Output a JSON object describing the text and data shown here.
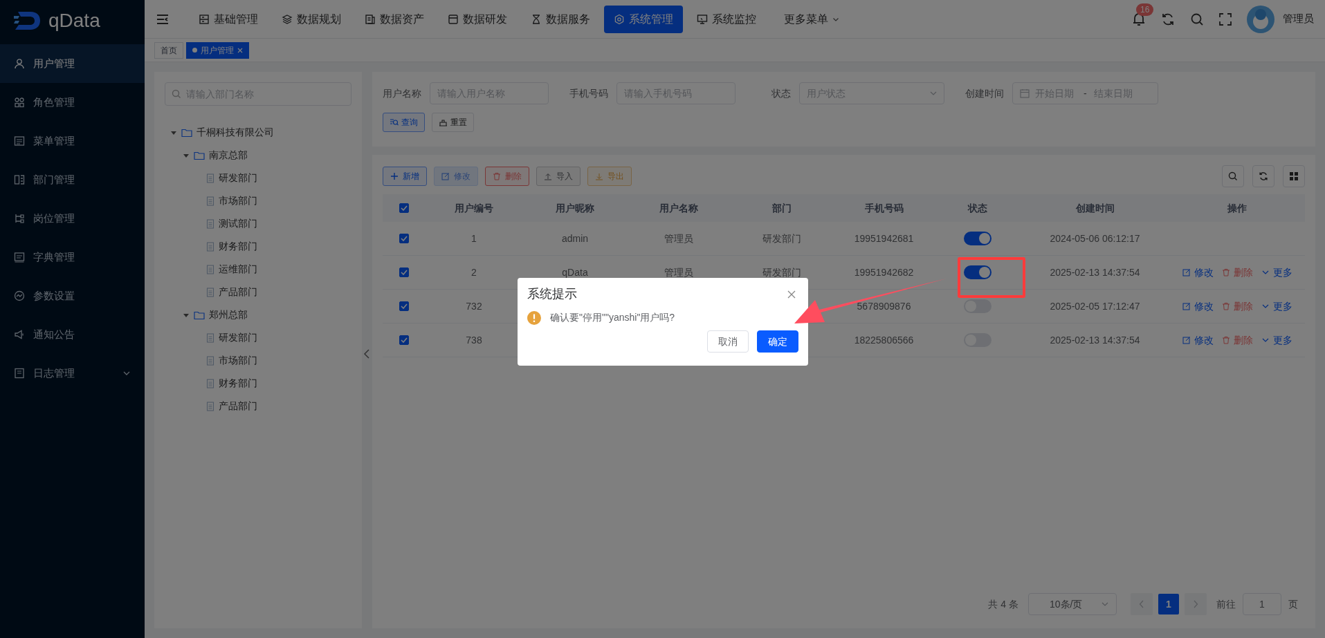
{
  "sidebar": {
    "logo": "qData",
    "items": [
      {
        "label": "用户管理",
        "selected": true,
        "kind": "link"
      },
      {
        "label": "角色管理",
        "selected": false,
        "kind": "link"
      },
      {
        "label": "菜单管理",
        "selected": false,
        "kind": "link"
      },
      {
        "label": "部门管理",
        "selected": false,
        "kind": "link"
      },
      {
        "label": "岗位管理",
        "selected": false,
        "kind": "link"
      },
      {
        "label": "字典管理",
        "selected": false,
        "kind": "link"
      },
      {
        "label": "参数设置",
        "selected": false,
        "kind": "link"
      },
      {
        "label": "通知公告",
        "selected": false,
        "kind": "link"
      },
      {
        "label": "日志管理",
        "selected": false,
        "kind": "group"
      }
    ]
  },
  "topnav": {
    "items": [
      {
        "label": "基础管理",
        "selected": false
      },
      {
        "label": "数据规划",
        "selected": false
      },
      {
        "label": "数据资产",
        "selected": false
      },
      {
        "label": "数据研发",
        "selected": false
      },
      {
        "label": "数据服务",
        "selected": false
      },
      {
        "label": "系统管理",
        "selected": true
      },
      {
        "label": "系统监控",
        "selected": false
      }
    ],
    "more": "更多菜单",
    "notifications": "16",
    "user": "管理员"
  },
  "tabs": [
    {
      "label": "首页",
      "selected": false,
      "closable": false
    },
    {
      "label": "用户管理",
      "selected": true,
      "closable": true
    }
  ],
  "tree": {
    "placeholder": "请输入部门名称",
    "nodes": [
      {
        "label": "千桐科技有限公司",
        "kind": "folder",
        "expanded": true,
        "children": [
          {
            "label": "南京总部",
            "kind": "folder",
            "expanded": true,
            "children": [
              {
                "label": "研发部门",
                "kind": "leaf"
              },
              {
                "label": "市场部门",
                "kind": "leaf"
              },
              {
                "label": "测试部门",
                "kind": "leaf"
              },
              {
                "label": "财务部门",
                "kind": "leaf"
              },
              {
                "label": "运维部门",
                "kind": "leaf"
              },
              {
                "label": "产品部门",
                "kind": "leaf"
              }
            ]
          },
          {
            "label": "郑州总部",
            "kind": "folder",
            "expanded": true,
            "children": [
              {
                "label": "研发部门",
                "kind": "leaf"
              },
              {
                "label": "市场部门",
                "kind": "leaf"
              },
              {
                "label": "财务部门",
                "kind": "leaf"
              },
              {
                "label": "产品部门",
                "kind": "leaf"
              }
            ]
          }
        ]
      }
    ]
  },
  "filters": [
    {
      "label": "用户名称",
      "kind": "input",
      "placeholder": "请输入用户名称"
    },
    {
      "label": "手机号码",
      "kind": "input",
      "placeholder": "请输入手机号码"
    },
    {
      "label": "状态",
      "kind": "select",
      "placeholder": "用户状态"
    },
    {
      "label": "创建时间",
      "kind": "daterange",
      "start_placeholder": "开始日期",
      "separator": "-",
      "end_placeholder": "结束日期"
    }
  ],
  "filter_buttons": [
    {
      "label": "查询",
      "kind": "primary"
    },
    {
      "label": "重置",
      "kind": "default"
    }
  ],
  "toolbar": [
    {
      "label": "新增",
      "kind": "add",
      "disabled": false
    },
    {
      "label": "修改",
      "kind": "edit",
      "disabled": true
    },
    {
      "label": "删除",
      "kind": "delete",
      "disabled": false
    },
    {
      "label": "导入",
      "kind": "import",
      "disabled": false
    },
    {
      "label": "导出",
      "kind": "export",
      "disabled": false
    }
  ],
  "table": {
    "all_checked": true,
    "columns": [
      "用户编号",
      "用户昵称",
      "用户名称",
      "部门",
      "手机号码",
      "状态",
      "创建时间",
      "操作"
    ],
    "rows": [
      {
        "checked": true,
        "id": "1",
        "nickname": "admin",
        "username": "管理员",
        "dept": "研发部门",
        "phone": "19951942681",
        "enabled": true,
        "created": "2024-05-06 06:12:17",
        "actions": []
      },
      {
        "checked": true,
        "id": "2",
        "nickname": "qData",
        "username": "管理员",
        "dept": "研发部门",
        "phone": "19951942682",
        "enabled": true,
        "created": "2025-02-13 14:37:54",
        "actions": [
          {
            "label": "修改",
            "kind": "edit"
          },
          {
            "label": "删除",
            "kind": "delete"
          },
          {
            "label": "更多",
            "kind": "more"
          }
        ]
      },
      {
        "checked": true,
        "id": "732",
        "phone": "5678909876",
        "enabled": false,
        "created": "2025-02-05 17:12:47",
        "actions": [
          {
            "label": "修改",
            "kind": "edit"
          },
          {
            "label": "删除",
            "kind": "delete"
          },
          {
            "label": "更多",
            "kind": "more"
          }
        ]
      },
      {
        "checked": true,
        "id": "738",
        "phone": "18225806566",
        "enabled": false,
        "created": "2025-02-13 14:37:54",
        "actions": [
          {
            "label": "修改",
            "kind": "edit"
          },
          {
            "label": "删除",
            "kind": "delete"
          },
          {
            "label": "更多",
            "kind": "more"
          }
        ]
      }
    ]
  },
  "pagination": {
    "total": "共 4 条",
    "page_size": "10条/页",
    "pages": [
      {
        "label": "1",
        "selected": true
      }
    ],
    "goto_label": "前往",
    "goto_value": "1",
    "page_suffix": "页"
  },
  "dialog": {
    "title": "系统提示",
    "message": "确认要\"停用\"\"yanshi\"用户吗?",
    "buttons": [
      {
        "label": "取消",
        "kind": "default"
      },
      {
        "label": "确定",
        "kind": "primary"
      }
    ]
  }
}
